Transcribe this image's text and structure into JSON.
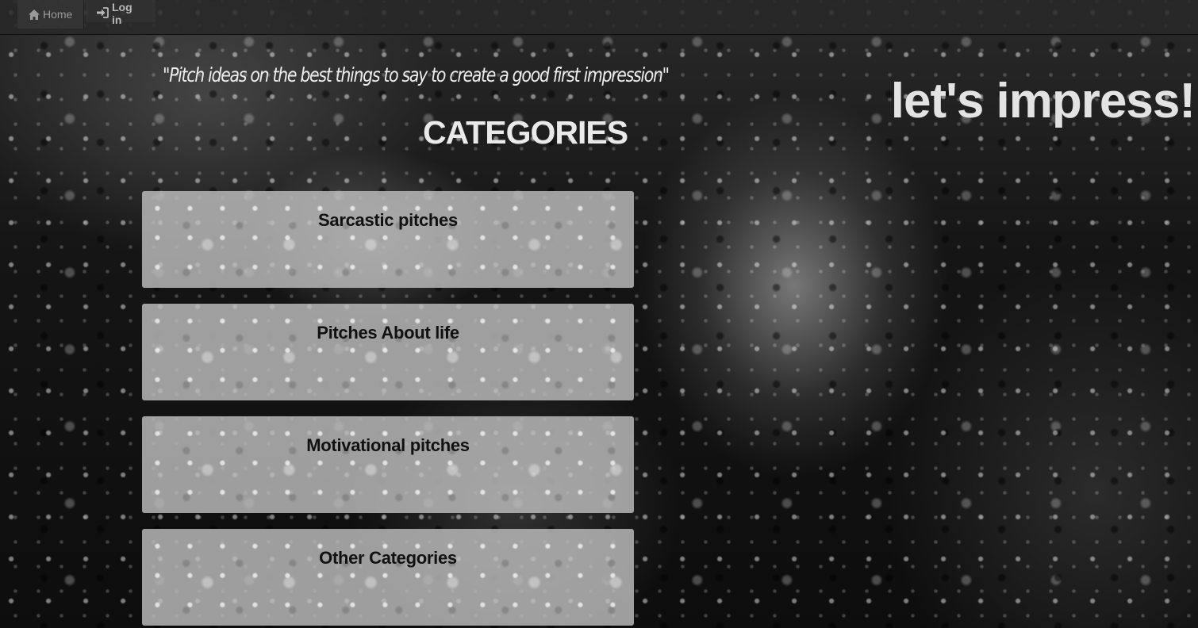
{
  "nav": {
    "home_label": "Home",
    "login_label": "Log in",
    "home_icon": "home-icon",
    "login_icon": "log-in-icon"
  },
  "hero": {
    "tagline": "\"Pitch ideas on the best things to say to create a good first impression\"",
    "brand": "let's impress!"
  },
  "categories": {
    "title": "CATEGORIES",
    "items": [
      {
        "label": "Sarcastic pitches"
      },
      {
        "label": "Pitches About life"
      },
      {
        "label": "Motivational pitches"
      },
      {
        "label": "Other Categories"
      }
    ]
  },
  "colors": {
    "navbar": "#282828",
    "card": "#bebebe",
    "text_light": "#eaeaea",
    "text_dark": "#111111"
  }
}
